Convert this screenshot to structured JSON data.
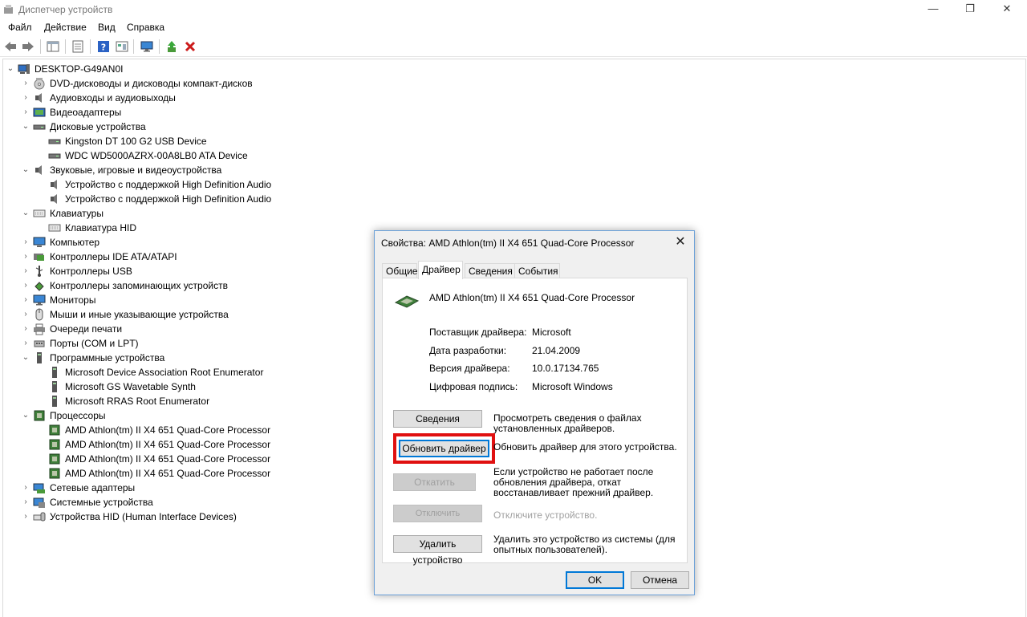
{
  "window": {
    "title": "Диспетчер устройств",
    "minimize_glyph": "—",
    "restore_glyph": "❐",
    "close_glyph": "✕"
  },
  "menu": [
    "Файл",
    "Действие",
    "Вид",
    "Справка"
  ],
  "toolbar": {
    "icons": [
      "back-icon",
      "forward-icon",
      "properties-pane-icon",
      "properties-icon",
      "help-icon",
      "view-icon",
      "monitor-icon",
      "update-driver-icon",
      "uninstall-icon"
    ],
    "uninstall_color": "#cc1b1b"
  },
  "tree": {
    "root": "DESKTOP-G49AN0I",
    "items": [
      {
        "label": "DVD-дисководы и дисководы компакт-дисков",
        "level": 1,
        "expander": "›",
        "icon": "dvd-icon"
      },
      {
        "label": "Аудиовходы и аудиовыходы",
        "level": 1,
        "expander": "›",
        "icon": "speaker-icon"
      },
      {
        "label": "Видеоадаптеры",
        "level": 1,
        "expander": "›",
        "icon": "display-adapter-icon"
      },
      {
        "label": "Дисковые устройства",
        "level": 1,
        "expander": "⌄",
        "icon": "disk-icon"
      },
      {
        "label": "Kingston DT 100 G2 USB Device",
        "level": 2,
        "expander": "",
        "icon": "disk-icon"
      },
      {
        "label": "WDC WD5000AZRX-00A8LB0 ATA Device",
        "level": 2,
        "expander": "",
        "icon": "disk-icon"
      },
      {
        "label": "Звуковые, игровые и видеоустройства",
        "level": 1,
        "expander": "⌄",
        "icon": "speaker-icon"
      },
      {
        "label": "Устройство с поддержкой High Definition Audio",
        "level": 2,
        "expander": "",
        "icon": "speaker-icon"
      },
      {
        "label": "Устройство с поддержкой High Definition Audio",
        "level": 2,
        "expander": "",
        "icon": "speaker-icon"
      },
      {
        "label": "Клавиатуры",
        "level": 1,
        "expander": "⌄",
        "icon": "keyboard-icon"
      },
      {
        "label": "Клавиатура HID",
        "level": 2,
        "expander": "",
        "icon": "keyboard-icon"
      },
      {
        "label": "Компьютер",
        "level": 1,
        "expander": "›",
        "icon": "computer-icon"
      },
      {
        "label": "Контроллеры IDE ATA/ATAPI",
        "level": 1,
        "expander": "›",
        "icon": "ide-controller-icon"
      },
      {
        "label": "Контроллеры USB",
        "level": 1,
        "expander": "›",
        "icon": "usb-icon"
      },
      {
        "label": "Контроллеры запоминающих устройств",
        "level": 1,
        "expander": "›",
        "icon": "storage-controller-icon"
      },
      {
        "label": "Мониторы",
        "level": 1,
        "expander": "›",
        "icon": "monitor-icon"
      },
      {
        "label": "Мыши и иные указывающие устройства",
        "level": 1,
        "expander": "›",
        "icon": "mouse-icon"
      },
      {
        "label": "Очереди печати",
        "level": 1,
        "expander": "›",
        "icon": "printer-icon"
      },
      {
        "label": "Порты (COM и LPT)",
        "level": 1,
        "expander": "›",
        "icon": "port-icon"
      },
      {
        "label": "Программные устройства",
        "level": 1,
        "expander": "⌄",
        "icon": "software-device-icon"
      },
      {
        "label": "Microsoft Device Association Root Enumerator",
        "level": 2,
        "expander": "",
        "icon": "software-device-icon"
      },
      {
        "label": "Microsoft GS Wavetable Synth",
        "level": 2,
        "expander": "",
        "icon": "software-device-icon"
      },
      {
        "label": "Microsoft RRAS Root Enumerator",
        "level": 2,
        "expander": "",
        "icon": "software-device-icon"
      },
      {
        "label": "Процессоры",
        "level": 1,
        "expander": "⌄",
        "icon": "processor-icon"
      },
      {
        "label": "AMD Athlon(tm) II X4 651 Quad-Core Processor",
        "level": 2,
        "expander": "",
        "icon": "processor-icon"
      },
      {
        "label": "AMD Athlon(tm) II X4 651 Quad-Core Processor",
        "level": 2,
        "expander": "",
        "icon": "processor-icon"
      },
      {
        "label": "AMD Athlon(tm) II X4 651 Quad-Core Processor",
        "level": 2,
        "expander": "",
        "icon": "processor-icon"
      },
      {
        "label": "AMD Athlon(tm) II X4 651 Quad-Core Processor",
        "level": 2,
        "expander": "",
        "icon": "processor-icon"
      },
      {
        "label": "Сетевые адаптеры",
        "level": 1,
        "expander": "›",
        "icon": "network-adapter-icon"
      },
      {
        "label": "Системные устройства",
        "level": 1,
        "expander": "›",
        "icon": "system-device-icon"
      },
      {
        "label": "Устройства HID (Human Interface Devices)",
        "level": 1,
        "expander": "›",
        "icon": "hid-icon"
      }
    ]
  },
  "dialog": {
    "title": "Свойства: AMD Athlon(tm) II X4 651 Quad-Core Processor",
    "close_glyph": "✕",
    "tabs": [
      "Общие",
      "Драйвер",
      "Сведения",
      "События"
    ],
    "active_tab": "Драйвер",
    "device_name": "AMD Athlon(tm) II X4 651 Quad-Core Processor",
    "properties": [
      {
        "label": "Поставщик драйвера:",
        "value": "Microsoft"
      },
      {
        "label": "Дата разработки:",
        "value": "21.04.2009"
      },
      {
        "label": "Версия драйвера:",
        "value": "10.0.17134.765"
      },
      {
        "label": "Цифровая подпись:",
        "value": "Microsoft Windows"
      }
    ],
    "actions": [
      {
        "button": "Сведения",
        "description": "Просмотреть сведения о файлах установленных драйверов.",
        "enabled": true
      },
      {
        "button": "Обновить драйвер",
        "description": "Обновить драйвер для этого устройства.",
        "enabled": true
      },
      {
        "button": "Откатить",
        "description": "Если устройство не работает после обновления драйвера, откат восстанавливает прежний драйвер.",
        "enabled": false
      },
      {
        "button": "Отключить устройство",
        "description": "Отключите устройство.",
        "enabled": false
      },
      {
        "button": "Удалить устройство",
        "description": "Удалить это устройство из системы (для опытных пользователей).",
        "enabled": true
      }
    ],
    "ok_label": "OK",
    "cancel_label": "Отмена",
    "highlight_color": "#e01010"
  }
}
